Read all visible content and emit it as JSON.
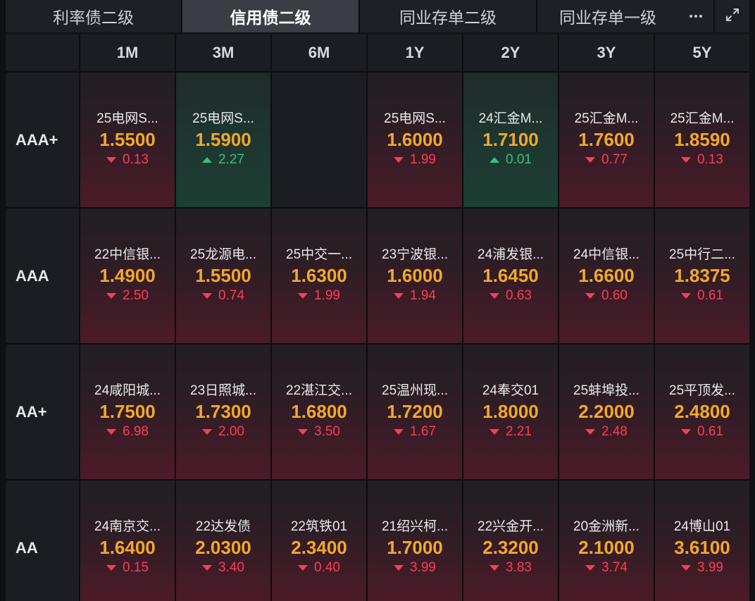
{
  "tabs": [
    {
      "label": "利率债二级",
      "active": false
    },
    {
      "label": "信用债二级",
      "active": true
    },
    {
      "label": "同业存单二级",
      "active": false
    },
    {
      "label": "同业存单一级",
      "active": false
    }
  ],
  "toolbar_icons": {
    "more": "more-icon",
    "expand": "expand-icon"
  },
  "colors": {
    "background": "#101115",
    "tab": "#1f2025",
    "active_tab": "#3b3d45",
    "yield": "#f4a72a",
    "down": "#ff3c56",
    "up": "#34c27f"
  },
  "table": {
    "columns": [
      "1M",
      "3M",
      "6M",
      "1Y",
      "2Y",
      "3Y",
      "5Y"
    ],
    "rows": [
      {
        "rating": "AAA+",
        "cells": [
          {
            "name": "25电网S...",
            "yield": "1.5500",
            "change": "0.13",
            "trend": "down-triangle-icon"
          },
          {
            "name": "25电网S...",
            "yield": "1.5900",
            "change": "2.27",
            "trend": "up-triangle-icon"
          },
          null,
          {
            "name": "25电网S...",
            "yield": "1.6000",
            "change": "1.99",
            "trend": "down-triangle-icon"
          },
          {
            "name": "24汇金M...",
            "yield": "1.7100",
            "change": "0.01",
            "trend": "up-triangle-icon"
          },
          {
            "name": "25汇金M...",
            "yield": "1.7600",
            "change": "0.77",
            "trend": "down-triangle-icon"
          },
          {
            "name": "25汇金M...",
            "yield": "1.8590",
            "change": "0.13",
            "trend": "down-triangle-icon"
          }
        ]
      },
      {
        "rating": "AAA",
        "cells": [
          {
            "name": "22中信银...",
            "yield": "1.4900",
            "change": "2.50",
            "trend": "down-triangle-icon"
          },
          {
            "name": "25龙源电...",
            "yield": "1.5500",
            "change": "0.74",
            "trend": "down-triangle-icon"
          },
          {
            "name": "25中交一...",
            "yield": "1.6300",
            "change": "1.99",
            "trend": "down-triangle-icon"
          },
          {
            "name": "23宁波银...",
            "yield": "1.6000",
            "change": "1.94",
            "trend": "down-triangle-icon"
          },
          {
            "name": "24浦发银...",
            "yield": "1.6450",
            "change": "0.63",
            "trend": "down-triangle-icon"
          },
          {
            "name": "24中信银...",
            "yield": "1.6600",
            "change": "0.60",
            "trend": "down-triangle-icon"
          },
          {
            "name": "25中行二...",
            "yield": "1.8375",
            "change": "0.61",
            "trend": "down-triangle-icon"
          }
        ]
      },
      {
        "rating": "AA+",
        "cells": [
          {
            "name": "24咸阳城...",
            "yield": "1.7500",
            "change": "6.98",
            "trend": "down-triangle-icon"
          },
          {
            "name": "23日照城...",
            "yield": "1.7300",
            "change": "2.00",
            "trend": "down-triangle-icon"
          },
          {
            "name": "22湛江交...",
            "yield": "1.6800",
            "change": "3.50",
            "trend": "down-triangle-icon"
          },
          {
            "name": "25温州现...",
            "yield": "1.7200",
            "change": "1.67",
            "trend": "down-triangle-icon"
          },
          {
            "name": "24奉交01",
            "yield": "1.8000",
            "change": "2.21",
            "trend": "down-triangle-icon"
          },
          {
            "name": "25蚌埠投...",
            "yield": "2.2000",
            "change": "2.48",
            "trend": "down-triangle-icon"
          },
          {
            "name": "25平顶发...",
            "yield": "2.4800",
            "change": "0.61",
            "trend": "down-triangle-icon"
          }
        ]
      },
      {
        "rating": "AA",
        "cells": [
          {
            "name": "24南京交...",
            "yield": "1.6400",
            "change": "0.15",
            "trend": "down-triangle-icon"
          },
          {
            "name": "22达发债",
            "yield": "2.0300",
            "change": "3.40",
            "trend": "down-triangle-icon"
          },
          {
            "name": "22筑铁01",
            "yield": "2.3400",
            "change": "0.40",
            "trend": "down-triangle-icon"
          },
          {
            "name": "21绍兴柯...",
            "yield": "1.7000",
            "change": "3.99",
            "trend": "down-triangle-icon"
          },
          {
            "name": "22兴金开...",
            "yield": "2.3200",
            "change": "3.83",
            "trend": "down-triangle-icon"
          },
          {
            "name": "20金洲新...",
            "yield": "2.1000",
            "change": "3.74",
            "trend": "down-triangle-icon"
          },
          {
            "name": "24博山01",
            "yield": "3.6100",
            "change": "3.99",
            "trend": "down-triangle-icon"
          }
        ]
      }
    ]
  }
}
